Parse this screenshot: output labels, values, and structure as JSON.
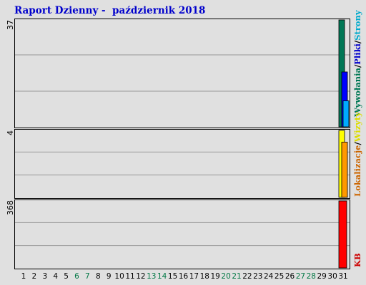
{
  "title": "Raport Dzienny -  październik 2018",
  "colors": {
    "background": "#e0e0e0",
    "title": "#0000cc",
    "weekend_label": "#007744",
    "strony": "#00aacc",
    "pliki": "#0000cc",
    "wywolania": "#007755",
    "wizyty": "#ffff00",
    "lokalizacje": "#cc6600",
    "kb": "#cc0000"
  },
  "chart_data": [
    {
      "type": "bar",
      "panel": "hits",
      "x": [
        1,
        2,
        3,
        4,
        5,
        6,
        7,
        8,
        9,
        10,
        11,
        12,
        13,
        14,
        15,
        16,
        17,
        18,
        19,
        20,
        21,
        22,
        23,
        24,
        25,
        26,
        27,
        28,
        29,
        30,
        31
      ],
      "weekend_days": [
        6,
        7,
        13,
        14,
        20,
        21,
        27,
        28
      ],
      "y_max_label": "37",
      "ylim": [
        0,
        37
      ],
      "series": [
        {
          "name": "Wywołania",
          "color": "#007755",
          "values": [
            0,
            0,
            0,
            0,
            0,
            0,
            0,
            0,
            0,
            0,
            0,
            0,
            0,
            0,
            0,
            0,
            0,
            0,
            0,
            0,
            0,
            0,
            0,
            0,
            0,
            0,
            0,
            0,
            0,
            0,
            37
          ]
        },
        {
          "name": "Pliki",
          "color": "#0000ff",
          "values": [
            0,
            0,
            0,
            0,
            0,
            0,
            0,
            0,
            0,
            0,
            0,
            0,
            0,
            0,
            0,
            0,
            0,
            0,
            0,
            0,
            0,
            0,
            0,
            0,
            0,
            0,
            0,
            0,
            0,
            0,
            19
          ]
        },
        {
          "name": "Strony",
          "color": "#00aaff",
          "values": [
            0,
            0,
            0,
            0,
            0,
            0,
            0,
            0,
            0,
            0,
            0,
            0,
            0,
            0,
            0,
            0,
            0,
            0,
            0,
            0,
            0,
            0,
            0,
            0,
            0,
            0,
            0,
            0,
            0,
            0,
            9
          ]
        }
      ],
      "legend": [
        "Wywołania",
        "/",
        "Pliki",
        "/",
        "Strony"
      ]
    },
    {
      "type": "bar",
      "panel": "visits",
      "y_max_label": "4",
      "ylim": [
        0,
        4
      ],
      "series": [
        {
          "name": "Wizyty",
          "color": "#ffff00",
          "values": [
            0,
            0,
            0,
            0,
            0,
            0,
            0,
            0,
            0,
            0,
            0,
            0,
            0,
            0,
            0,
            0,
            0,
            0,
            0,
            0,
            0,
            0,
            0,
            0,
            0,
            0,
            0,
            0,
            0,
            0,
            4
          ]
        },
        {
          "name": "Lokalizacje",
          "color": "#ff9900",
          "values": [
            0,
            0,
            0,
            0,
            0,
            0,
            0,
            0,
            0,
            0,
            0,
            0,
            0,
            0,
            0,
            0,
            0,
            0,
            0,
            0,
            0,
            0,
            0,
            0,
            0,
            0,
            0,
            0,
            0,
            0,
            3.3
          ]
        }
      ],
      "legend": [
        "Lokalizacje",
        "/",
        "Wizyty"
      ]
    },
    {
      "type": "bar",
      "panel": "kb",
      "y_max_label": "368",
      "ylim": [
        0,
        368
      ],
      "series": [
        {
          "name": "KB",
          "color": "#ff0000",
          "values": [
            0,
            0,
            0,
            0,
            0,
            0,
            0,
            0,
            0,
            0,
            0,
            0,
            0,
            0,
            0,
            0,
            0,
            0,
            0,
            0,
            0,
            0,
            0,
            0,
            0,
            0,
            0,
            0,
            0,
            0,
            368
          ]
        }
      ],
      "legend": [
        "KB"
      ]
    }
  ]
}
